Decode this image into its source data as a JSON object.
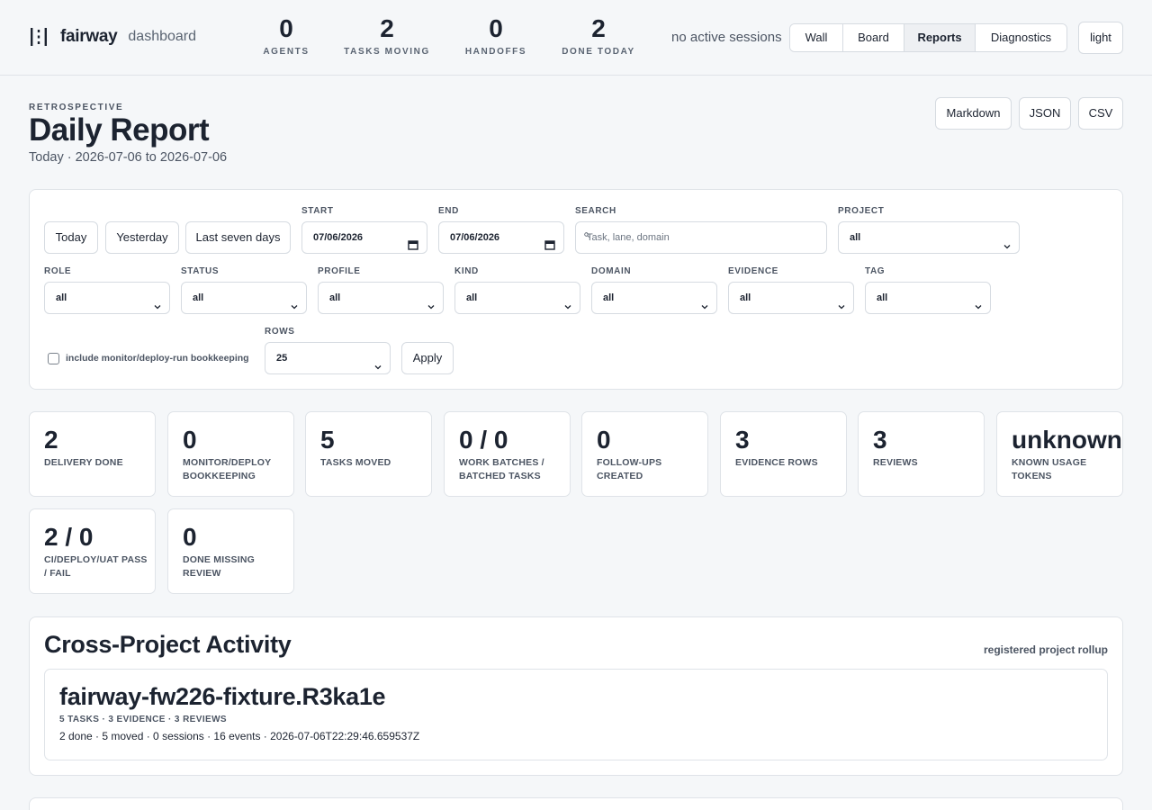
{
  "header": {
    "brand": "fairway",
    "subtitle": "dashboard",
    "stats": [
      {
        "value": "0",
        "label": "AGENTS"
      },
      {
        "value": "2",
        "label": "TASKS MOVING"
      },
      {
        "value": "0",
        "label": "HANDOFFS"
      },
      {
        "value": "2",
        "label": "DONE TODAY"
      }
    ],
    "sessions": "no active sessions",
    "nav": [
      "Wall",
      "Board",
      "Reports",
      "Diagnostics"
    ],
    "active_nav": "Reports",
    "theme": "light"
  },
  "report": {
    "eyebrow": "RETROSPECTIVE",
    "title": "Daily Report",
    "subtitle": "Today · 2026-07-06 to 2026-07-06",
    "exports": [
      "Markdown",
      "JSON",
      "CSV"
    ]
  },
  "filters": {
    "quick": [
      "Today",
      "Yesterday",
      "Last seven days"
    ],
    "start_label": "START",
    "start_value": "07/06/2026",
    "end_label": "END",
    "end_value": "07/06/2026",
    "search_label": "SEARCH",
    "search_placeholder": "Task, lane, domain",
    "project_label": "PROJECT",
    "project_value": "all",
    "selects": [
      {
        "label": "ROLE",
        "value": "all"
      },
      {
        "label": "STATUS",
        "value": "all"
      },
      {
        "label": "PROFILE",
        "value": "all"
      },
      {
        "label": "KIND",
        "value": "all"
      },
      {
        "label": "DOMAIN",
        "value": "all"
      },
      {
        "label": "EVIDENCE",
        "value": "all"
      },
      {
        "label": "TAG",
        "value": "all"
      }
    ],
    "bookkeeping_label": "include monitor/deploy-run bookkeeping",
    "rows_label": "ROWS",
    "rows_value": "25",
    "apply": "Apply"
  },
  "metrics": [
    {
      "value": "2",
      "label": "DELIVERY DONE"
    },
    {
      "value": "0",
      "label": "MONITOR/DEPLOY BOOKKEEPING"
    },
    {
      "value": "5",
      "label": "TASKS MOVED"
    },
    {
      "value": "0 / 0",
      "label": "WORK BATCHES / BATCHED TASKS"
    },
    {
      "value": "0",
      "label": "FOLLOW-UPS CREATED"
    },
    {
      "value": "3",
      "label": "EVIDENCE ROWS"
    },
    {
      "value": "3",
      "label": "REVIEWS"
    },
    {
      "value": "unknown",
      "label": "KNOWN USAGE TOKENS"
    },
    {
      "value": "2 / 0",
      "label": "CI/DEPLOY/UAT PASS / FAIL"
    },
    {
      "value": "0",
      "label": "DONE MISSING REVIEW"
    }
  ],
  "cross_project": {
    "title": "Cross-Project Activity",
    "note": "registered project rollup",
    "project": {
      "name": "fairway-fw226-fixture.R3ka1e",
      "meta": "5 TASKS · 3 EVIDENCE · 3 REVIEWS",
      "detail": "2 done · 5 moved · 0 sessions · 16 events · 2026-07-06T22:29:46.659537Z"
    }
  }
}
